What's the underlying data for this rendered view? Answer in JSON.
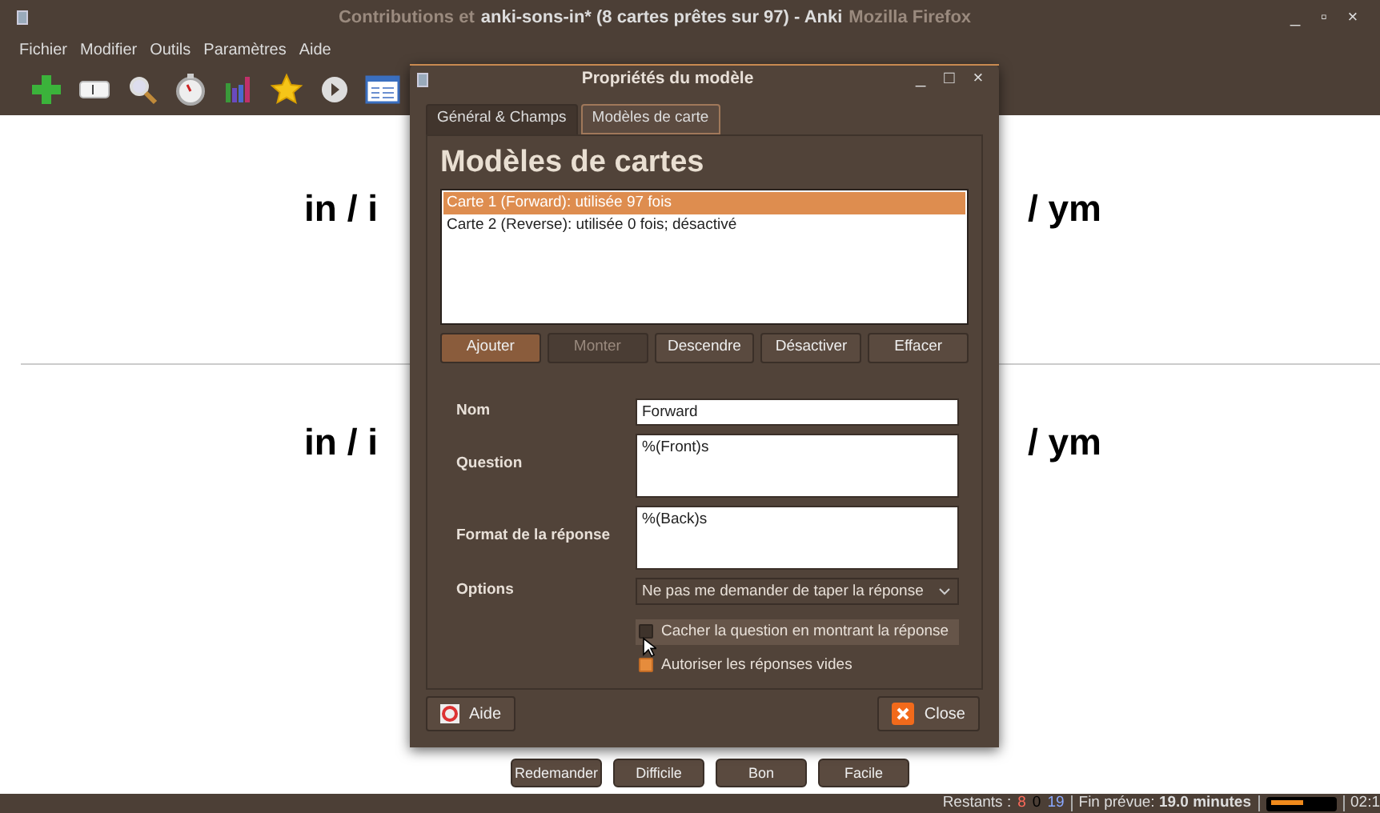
{
  "window": {
    "title_parts": [
      {
        "text": "Contributions et",
        "dim": true
      },
      {
        "text": "anki-sons-in* (8 cartes prêtes sur 97) - Anki",
        "dim": false
      },
      {
        "text": "Mozilla Firefox",
        "dim": true
      }
    ],
    "controls": [
      "_",
      "▫",
      "×"
    ]
  },
  "menu": [
    "Fichier",
    "Modifier",
    "Outils",
    "Paramètres",
    "Aide"
  ],
  "toolbar": [
    {
      "kind": "add"
    },
    {
      "kind": "card"
    },
    {
      "kind": "search"
    },
    {
      "kind": "timer"
    },
    {
      "kind": "chart"
    },
    {
      "kind": "star"
    },
    {
      "kind": "play"
    },
    {
      "kind": "list"
    }
  ],
  "review": {
    "rows": [
      {
        "left": "in / i",
        "right": "/ ym"
      },
      {
        "left": "in / i",
        "right": "/ ym"
      }
    ],
    "answer_buttons": [
      "Redemander",
      "Difficile",
      "Bon",
      "Facile"
    ]
  },
  "status_bar": {
    "label": "Restants :",
    "counts": [
      {
        "text": "8",
        "color": "#ff6a5a"
      },
      {
        "text": "0",
        "color": "#000000"
      },
      {
        "text": "19",
        "color": "#8aa8ff"
      }
    ],
    "eta_label": "Fin prévue:",
    "eta_value": "19.0 minutes",
    "progress": {
      "level": 0.55
    },
    "time": "02:1"
  },
  "dialog": {
    "title": "Propriétés du modèle",
    "controls": [
      "_",
      "□",
      "×"
    ],
    "tabs": [
      {
        "label": "Général & Champs",
        "selected": false
      },
      {
        "label": "Modèles de carte",
        "selected": true
      }
    ],
    "heading": "Modèles de cartes",
    "templates": [
      {
        "label": "Carte 1 (Forward): utilisée 97  fois",
        "selected": true
      },
      {
        "label": "Carte 2 (Reverse): utilisée 0  fois; désactivé",
        "selected": false
      }
    ],
    "buttons": [
      {
        "label": "Ajouter",
        "disabled": false,
        "focused": true
      },
      {
        "label": "Monter",
        "disabled": true,
        "focused": false
      },
      {
        "label": "Descendre",
        "disabled": false,
        "focused": false
      },
      {
        "label": "Désactiver",
        "disabled": false,
        "focused": false
      },
      {
        "label": "Effacer",
        "disabled": false,
        "focused": false
      }
    ],
    "fields": [
      {
        "label": "Nom",
        "kind": "line",
        "value": "Forward"
      },
      {
        "label": "Question",
        "kind": "area",
        "value": "%(Front)s"
      },
      {
        "label": "Format de la réponse",
        "kind": "area",
        "value": "%(Back)s"
      },
      {
        "label": "Options",
        "kind": "select",
        "value": "Ne pas me demander de taper la réponse"
      }
    ],
    "checkboxes": [
      {
        "label": "Cacher la question en montrant la réponse",
        "checked": false,
        "hover": true
      },
      {
        "label": "Autoriser les réponses vides",
        "checked": true,
        "hover": false
      }
    ],
    "help_button": "Aide",
    "close_button": "Close"
  }
}
